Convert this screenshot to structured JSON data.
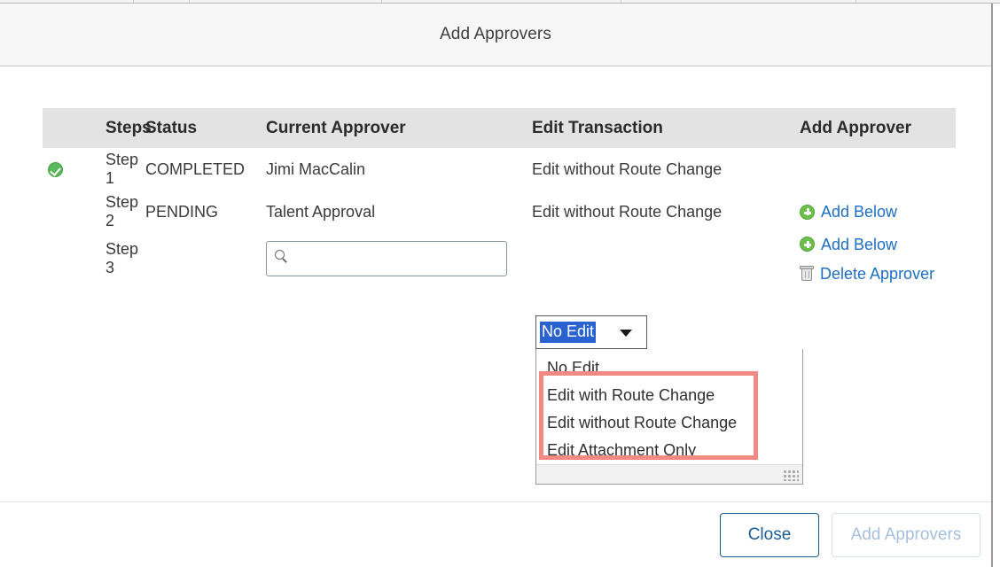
{
  "background_strip": {
    "divider_positions": [
      150,
      213,
      430,
      700,
      965,
      1340
    ]
  },
  "modal": {
    "title": "Add Approvers",
    "table": {
      "columns": [
        "Steps",
        "Status",
        "Current Approver",
        "Edit Transaction",
        "Add Approver"
      ],
      "rows": [
        {
          "flag_icon": "completed-check-icon",
          "step": "Step 1",
          "status": "COMPLETED",
          "current_approver": "Jimi MacCalin",
          "edit_transaction": "Edit without Route Change",
          "actions": []
        },
        {
          "flag_icon": "",
          "step": "Step 2",
          "status": "PENDING",
          "current_approver": "Talent Approval",
          "edit_transaction": "Edit without Route Change",
          "actions": [
            {
              "icon": "add-circle-icon",
              "label": "Add Below"
            }
          ]
        },
        {
          "flag_icon": "",
          "step": "Step 3",
          "status": "",
          "current_approver": "",
          "edit_transaction": "",
          "actions": [
            {
              "icon": "add-circle-icon",
              "label": "Add Below"
            },
            {
              "icon": "trash-icon",
              "label": "Delete Approver"
            }
          ]
        }
      ]
    },
    "approver_search": {
      "value": "",
      "placeholder": "",
      "icon": "search-icon"
    },
    "edit_transaction_select": {
      "selected": "No Edit",
      "expanded": true,
      "options": [
        "No Edit",
        "Edit with Route Change",
        "Edit without Route Change",
        "Edit Attachment Only"
      ],
      "highlight_color": "#2a62d0",
      "resize_grip": "resize-grip-icon"
    },
    "annotation": {
      "type": "highlight-rectangle",
      "color": "#f08a82",
      "covers": [
        "Edit with Route Change",
        "Edit without Route Change",
        "Edit Attachment Only"
      ]
    },
    "footer": {
      "close_label": "Close",
      "add_label": "Add Approvers",
      "add_disabled": true
    }
  }
}
